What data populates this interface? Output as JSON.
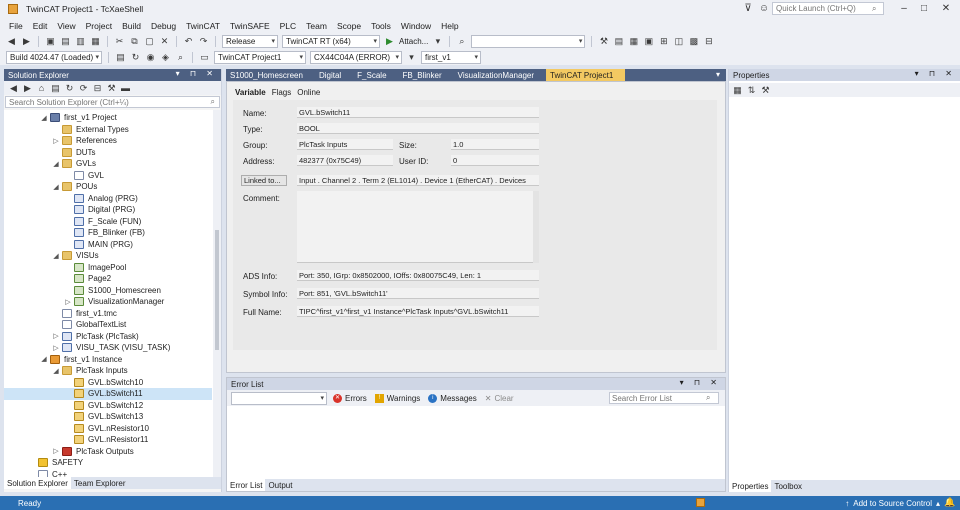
{
  "window": {
    "title": "TwinCAT Project1 - TcXaeShell",
    "quick_launch_placeholder": "Quick Launch (Ctrl+Q)"
  },
  "menu": [
    "File",
    "Edit",
    "View",
    "Project",
    "Build",
    "Debug",
    "TwinCAT",
    "TwinSAFE",
    "PLC",
    "Team",
    "Scope",
    "Tools",
    "Window",
    "Help"
  ],
  "toolbar": {
    "configuration": "Release",
    "platform": "TwinCAT RT (x64)",
    "attach_label": "Attach...",
    "build_version": "Build 4024.47 (Loaded)",
    "project_selector": "TwinCAT Project1",
    "target_selector": "CX44C04A (ERROR)",
    "plc_selector": "first_v1"
  },
  "solution_explorer": {
    "title": "Solution Explorer",
    "search_placeholder": "Search Solution Explorer (Ctrl+¼)",
    "items": [
      {
        "label": "first_v1 Project",
        "indent": 3,
        "twisty": "◢",
        "icon": "ic-proj"
      },
      {
        "label": "External Types",
        "indent": 4,
        "twisty": "",
        "icon": "ic-folder"
      },
      {
        "label": "References",
        "indent": 4,
        "twisty": "▷",
        "icon": "ic-folder"
      },
      {
        "label": "DUTs",
        "indent": 4,
        "twisty": "",
        "icon": "ic-folder"
      },
      {
        "label": "GVLs",
        "indent": 4,
        "twisty": "◢",
        "icon": "ic-folder"
      },
      {
        "label": "GVL",
        "indent": 5,
        "twisty": "",
        "icon": "ic-file"
      },
      {
        "label": "POUs",
        "indent": 4,
        "twisty": "◢",
        "icon": "ic-folder"
      },
      {
        "label": "Analog (PRG)",
        "indent": 5,
        "twisty": "",
        "icon": "ic-prog"
      },
      {
        "label": "Digital (PRG)",
        "indent": 5,
        "twisty": "",
        "icon": "ic-prog"
      },
      {
        "label": "F_Scale (FUN)",
        "indent": 5,
        "twisty": "",
        "icon": "ic-prog"
      },
      {
        "label": "FB_Blinker (FB)",
        "indent": 5,
        "twisty": "",
        "icon": "ic-prog"
      },
      {
        "label": "MAIN (PRG)",
        "indent": 5,
        "twisty": "",
        "icon": "ic-prog"
      },
      {
        "label": "VISUs",
        "indent": 4,
        "twisty": "◢",
        "icon": "ic-folder"
      },
      {
        "label": "ImagePool",
        "indent": 5,
        "twisty": "",
        "icon": "ic-visu"
      },
      {
        "label": "Page2",
        "indent": 5,
        "twisty": "",
        "icon": "ic-visu"
      },
      {
        "label": "S1000_Homescreen",
        "indent": 5,
        "twisty": "",
        "icon": "ic-visu"
      },
      {
        "label": "VisualizationManager",
        "indent": 5,
        "twisty": "▷",
        "icon": "ic-visu"
      },
      {
        "label": "first_v1.tmc",
        "indent": 4,
        "twisty": "",
        "icon": "ic-file"
      },
      {
        "label": "GlobalTextList",
        "indent": 4,
        "twisty": "",
        "icon": "ic-file"
      },
      {
        "label": "PlcTask (PlcTask)",
        "indent": 4,
        "twisty": "▷",
        "icon": "ic-prog"
      },
      {
        "label": "VISU_TASK (VISU_TASK)",
        "indent": 4,
        "twisty": "▷",
        "icon": "ic-prog"
      },
      {
        "label": "first_v1 Instance",
        "indent": 3,
        "twisty": "◢",
        "icon": "ic-inst"
      },
      {
        "label": "PlcTask Inputs",
        "indent": 4,
        "twisty": "◢",
        "icon": "ic-folder"
      },
      {
        "label": "GVL.bSwitch10",
        "indent": 5,
        "twisty": "",
        "icon": "ic-var"
      },
      {
        "label": "GVL.bSwitch11",
        "indent": 5,
        "twisty": "",
        "icon": "ic-var",
        "selected": true
      },
      {
        "label": "GVL.bSwitch12",
        "indent": 5,
        "twisty": "",
        "icon": "ic-var"
      },
      {
        "label": "GVL.bSwitch13",
        "indent": 5,
        "twisty": "",
        "icon": "ic-var"
      },
      {
        "label": "GVL.nResistor10",
        "indent": 5,
        "twisty": "",
        "icon": "ic-var"
      },
      {
        "label": "GVL.nResistor11",
        "indent": 5,
        "twisty": "",
        "icon": "ic-var"
      },
      {
        "label": "PlcTask Outputs",
        "indent": 4,
        "twisty": "▷",
        "icon": "ic-task"
      },
      {
        "label": "SAFETY",
        "indent": 2,
        "twisty": "",
        "icon": "ic-safety"
      },
      {
        "label": "C++",
        "indent": 2,
        "twisty": "",
        "icon": "ic-file"
      }
    ],
    "bottom_tabs": [
      "Solution Explorer",
      "Team Explorer"
    ]
  },
  "document": {
    "tabs": [
      "S1000_Homescreen",
      "Digital",
      "F_Scale",
      "FB_Blinker",
      "VisualizationManager",
      "TwinCAT Project1"
    ],
    "sub_tabs": [
      "Variable",
      "Flags",
      "Online"
    ],
    "fields": {
      "name_label": "Name:",
      "name": "GVL.bSwitch11",
      "type_label": "Type:",
      "type": "BOOL",
      "group_label": "Group:",
      "group": "PlcTask Inputs",
      "size_label": "Size:",
      "size": "1.0",
      "address_label": "Address:",
      "address": "482377 (0x75C49)",
      "userid_label": "User ID:",
      "userid": "0",
      "linked_label": "Linked to...",
      "linked": "Input . Channel 2 . Term 2 (EL1014) . Device 1 (EtherCAT) . Devices",
      "comment_label": "Comment:",
      "ads_label": "ADS Info:",
      "ads": "Port: 350, IGrp: 0x8502000, IOffs: 0x80075C49, Len: 1",
      "symbol_label": "Symbol Info:",
      "symbol": "Port: 851, 'GVL.bSwitch11'",
      "fullname_label": "Full Name:",
      "fullname": "TIPC^first_v1^first_v1 Instance^PlcTask Inputs^GVL.bSwitch11"
    }
  },
  "properties": {
    "title": "Properties",
    "bottom_tabs": [
      "Properties",
      "Toolbox"
    ]
  },
  "error_list": {
    "title": "Error List",
    "errors_label": "Errors",
    "warnings_label": "Warnings",
    "messages_label": "Messages",
    "clear_label": "Clear",
    "search_placeholder": "Search Error List",
    "bottom_tabs": [
      "Error List",
      "Output"
    ]
  },
  "status": {
    "text": "Ready",
    "source_control": "Add to Source Control"
  }
}
